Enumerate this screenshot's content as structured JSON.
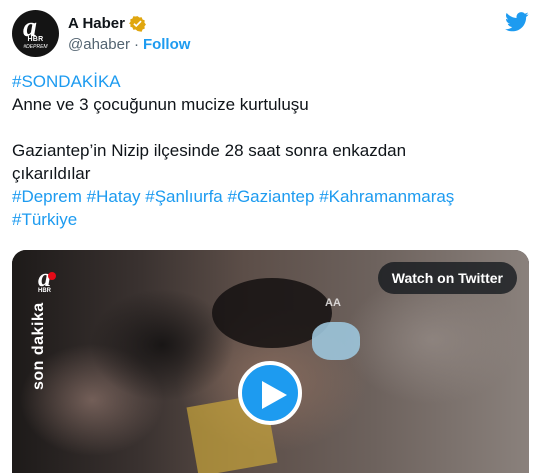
{
  "author": {
    "display_name": "A Haber",
    "handle": "@ahaber",
    "separator": "·",
    "follow_label": "Follow",
    "avatar_letter": "a",
    "avatar_sub": "HBR",
    "avatar_tag": "#DEPREM",
    "verified_icon": "verified-badge-icon",
    "verified_color": "#e0a60e"
  },
  "tweet": {
    "hashtag_top": "#SONDAKİKA",
    "line1": "Anne ve 3 çocuğunun mucize kurtuluşu",
    "line2": "Gaziantep’in Nizip ilçesinde 28 saat sonra enkazdan",
    "line3": "çıkarıldılar",
    "hashtags": [
      "#Deprem",
      "#Hatay",
      "#Şanlıurfa",
      "#Gaziantep",
      "#Kahramanmaraş",
      "#Türkiye"
    ]
  },
  "media": {
    "watch_label": "Watch on Twitter",
    "channel_letter": "a",
    "channel_sub": "HBR",
    "overlay_text": "son dakika",
    "agency_mark": "AA",
    "play_icon": "play-icon"
  },
  "colors": {
    "accent": "#1d9bf0",
    "text": "#0f1419",
    "muted": "#536471"
  },
  "brand_icon": "twitter-bird-icon"
}
